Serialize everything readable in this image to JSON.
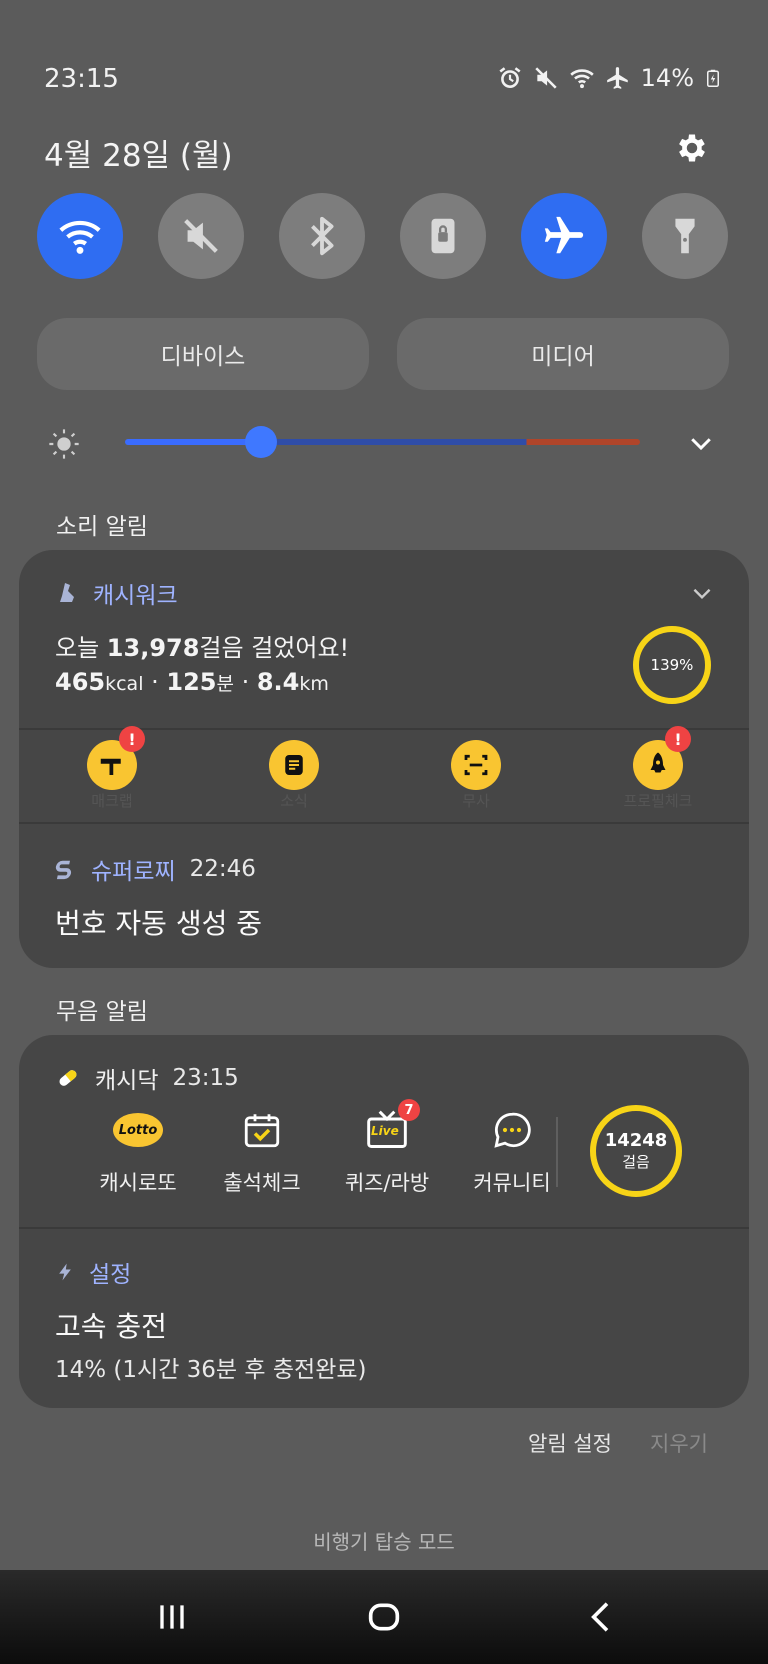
{
  "status_bar": {
    "time": "23:15",
    "battery": "14%",
    "icons": [
      "alarm-icon",
      "mute-icon",
      "wifi-icon",
      "airplane-icon",
      "battery-charging-icon"
    ]
  },
  "header": {
    "date": "4월 28일 (월)"
  },
  "quick_toggles": [
    {
      "name": "wifi",
      "icon": "wifi-icon",
      "on": true
    },
    {
      "name": "sound",
      "icon": "mute-icon",
      "on": false
    },
    {
      "name": "bluetooth",
      "icon": "bluetooth-icon",
      "on": false
    },
    {
      "name": "rotation-lock",
      "icon": "lock-icon",
      "on": false
    },
    {
      "name": "airplane",
      "icon": "airplane-icon",
      "on": true
    },
    {
      "name": "flashlight",
      "icon": "flashlight-icon",
      "on": false
    }
  ],
  "pills": {
    "devices": "디바이스",
    "media": "미디어"
  },
  "brightness": {
    "level": 0.25
  },
  "sections": {
    "sound_alerts": "소리 알림",
    "silent_alerts": "무음 알림"
  },
  "cashwalk": {
    "app_name": "캐시워크",
    "steps_prefix": "오늘 ",
    "steps": "13,978",
    "steps_suffix": "걸음 걸었어요!",
    "kcal": "465",
    "kcal_unit": "kcal",
    "minutes": "125",
    "minutes_unit": "분",
    "distance": "8.4",
    "distance_unit": "km",
    "sep": " · ",
    "progress": "139%",
    "shortcuts": [
      "매크랩",
      "소식",
      "무사",
      "프로필체크"
    ]
  },
  "superroji": {
    "app_name": "슈퍼로찌",
    "time": "22:46",
    "title": "번호 자동 생성 중"
  },
  "cashdoc": {
    "app_name": "캐시닥",
    "time": "23:15",
    "items": [
      {
        "label": "캐시로또",
        "icon": "lotto-icon",
        "icon_text": "Lotto"
      },
      {
        "label": "출석체크",
        "icon": "calendar-check-icon"
      },
      {
        "label": "퀴즈/라방",
        "icon": "live-tv-icon",
        "icon_text": "Live",
        "badge": "7"
      },
      {
        "label": "커뮤니티",
        "icon": "chat-bubble-icon"
      }
    ],
    "steps": "14248",
    "steps_label": "걸음"
  },
  "settings_notif": {
    "app_name": "설정",
    "title": "고속 충전",
    "subtitle": "14% (1시간 36분 후 충전완료)"
  },
  "footer": {
    "notif_settings": "알림 설정",
    "clear": "지우기"
  },
  "mode_label": "비행기 탑승 모드",
  "colors": {
    "accent": "#2f6df2",
    "ring": "#f7d417",
    "app_name": "#9fb3ff",
    "badge": "#ef4343"
  }
}
